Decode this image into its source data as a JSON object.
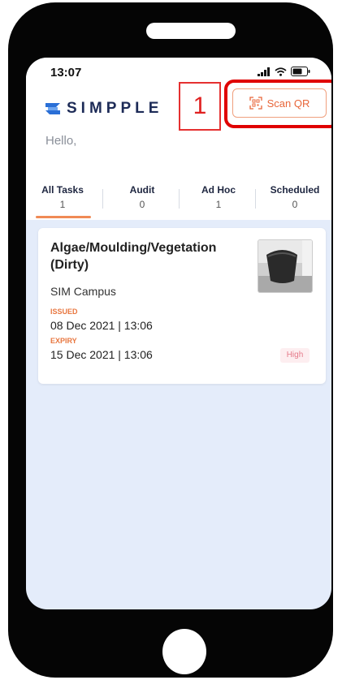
{
  "status_bar": {
    "time": "13:07"
  },
  "brand": {
    "name": "SIMPPLE",
    "logo_color": "#2a6fd6"
  },
  "greeting": "Hello,",
  "annotation": {
    "number": "1",
    "color": "#e00000"
  },
  "scan_button": {
    "label": "Scan QR",
    "icon": "qr-scan-icon",
    "color": "#e8663a"
  },
  "tabs": [
    {
      "label": "All Tasks",
      "count": "1",
      "active": true
    },
    {
      "label": "Audit",
      "count": "0"
    },
    {
      "label": "Ad Hoc",
      "count": "1"
    },
    {
      "label": "Scheduled",
      "count": "0"
    }
  ],
  "task": {
    "title": "Algae/Moulding/Vegetation (Dirty)",
    "location": "SIM Campus",
    "issued_label": "ISSUED",
    "issued_value": "08 Dec 2021 | 13:06",
    "expiry_label": "EXPIRY",
    "expiry_value": "15 Dec 2021 | 13:06",
    "priority": "High"
  }
}
